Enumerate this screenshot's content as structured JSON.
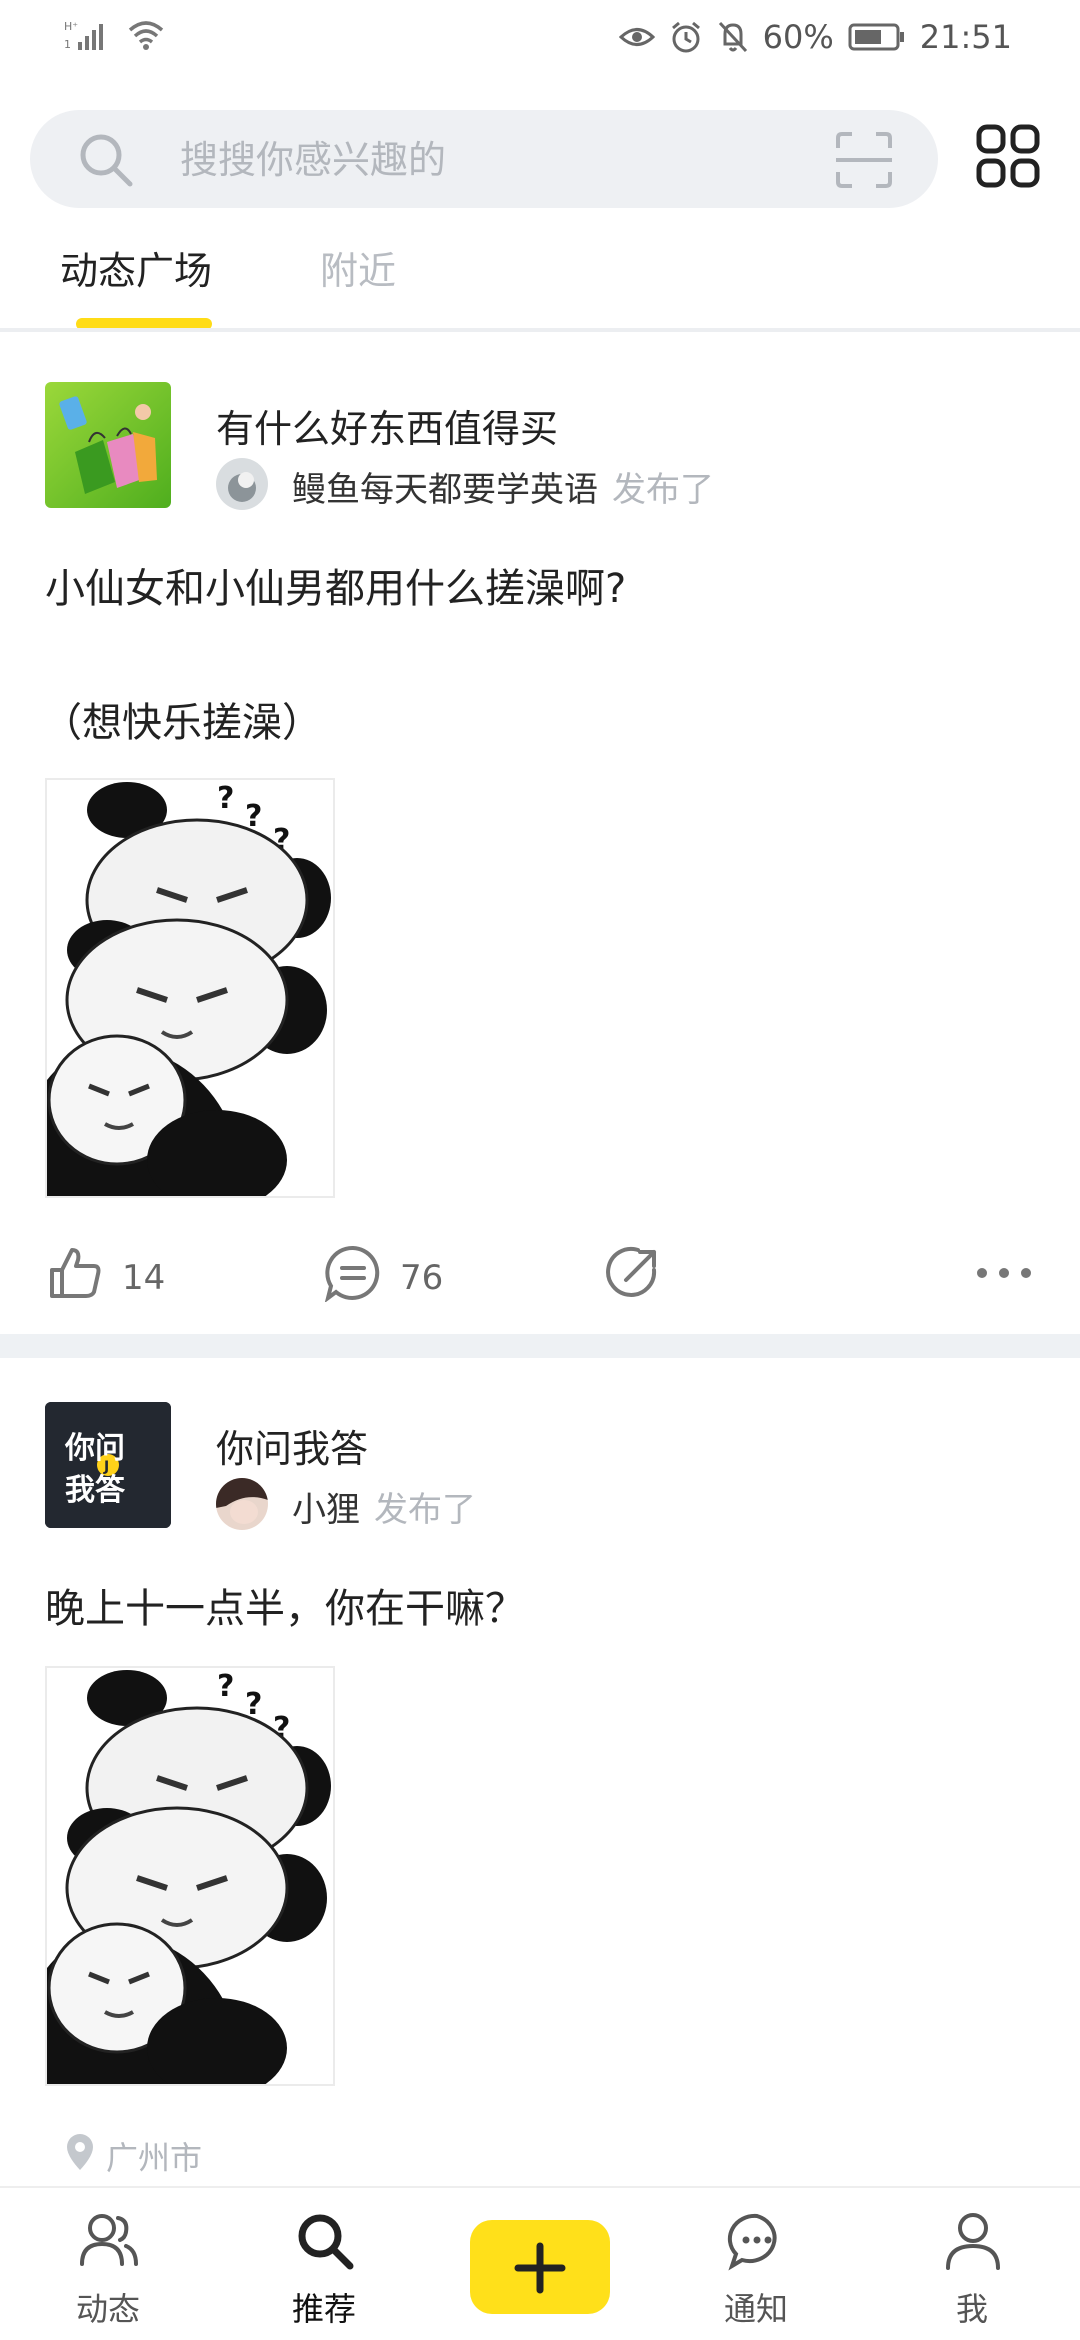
{
  "status_bar": {
    "battery_text": "60%",
    "time": "21:51",
    "icons": [
      "signal-icon",
      "wifi-icon",
      "eye-icon",
      "alarm-icon",
      "mute-icon",
      "battery-icon"
    ]
  },
  "search": {
    "placeholder": "搜搜你感兴趣的"
  },
  "tabs": [
    {
      "label": "动态广场",
      "active": true
    },
    {
      "label": "附近",
      "active": false
    }
  ],
  "posts": [
    {
      "group": "有什么好东西值得买",
      "author": "鳗鱼每天都要学英语",
      "action_suffix": "发布了",
      "text_line1": "小仙女和小仙男都用什么搓澡啊?",
      "text_line2": "（想快乐搓澡）",
      "likes": "14",
      "comments": "76"
    },
    {
      "group": "你问我答",
      "group_thumb_text": [
        "你问",
        "我答"
      ],
      "author": "小狸",
      "action_suffix": "发布了",
      "text_line1": "晚上十一点半，你在干嘛？",
      "location": "广州市"
    }
  ],
  "bottom_nav": [
    {
      "label": "动态",
      "icon": "users-icon",
      "active": false
    },
    {
      "label": "推荐",
      "icon": "search-icon",
      "active": true
    },
    {
      "label": "",
      "icon": "plus-icon",
      "active": false
    },
    {
      "label": "通知",
      "icon": "chat-bubble-icon",
      "active": false
    },
    {
      "label": "我",
      "icon": "person-icon",
      "active": false
    }
  ],
  "colors": {
    "accent_yellow": "#ffdc17",
    "text_primary": "#222222",
    "text_muted": "#b3b7bd",
    "search_bg": "#eef0f3"
  }
}
